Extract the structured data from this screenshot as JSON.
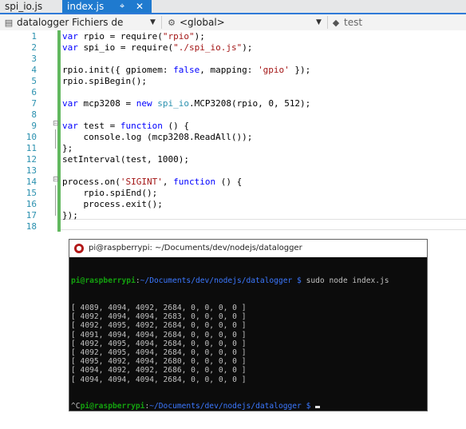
{
  "tabs": [
    {
      "label": "spi_io.js",
      "active": false
    },
    {
      "label": "index.js",
      "active": true,
      "pin": "⌖",
      "close": "✕"
    }
  ],
  "navbar": {
    "project": "datalogger Fichiers de contenu",
    "scope": "<global>",
    "member": "test"
  },
  "editor": {
    "line_numbers": [
      "1",
      "2",
      "3",
      "4",
      "5",
      "6",
      "7",
      "8",
      "9",
      "10",
      "11",
      "12",
      "13",
      "14",
      "15",
      "16",
      "17",
      "18"
    ],
    "lines": [
      {
        "parts": [
          {
            "t": "kw",
            "v": "var"
          },
          {
            "t": "n",
            "v": " rpio = require("
          },
          {
            "t": "str",
            "v": "\"rpio\""
          },
          {
            "t": "n",
            "v": ");"
          }
        ]
      },
      {
        "parts": [
          {
            "t": "kw",
            "v": "var"
          },
          {
            "t": "n",
            "v": " spi_io = require("
          },
          {
            "t": "str",
            "v": "\"./spi_io.js\""
          },
          {
            "t": "n",
            "v": ");"
          }
        ]
      },
      {
        "parts": []
      },
      {
        "parts": [
          {
            "t": "n",
            "v": "rpio.init({ gpiomem: "
          },
          {
            "t": "kw",
            "v": "false"
          },
          {
            "t": "n",
            "v": ", mapping: "
          },
          {
            "t": "str",
            "v": "'gpio'"
          },
          {
            "t": "n",
            "v": " });"
          }
        ]
      },
      {
        "parts": [
          {
            "t": "n",
            "v": "rpio.spiBegin();"
          }
        ]
      },
      {
        "parts": []
      },
      {
        "parts": [
          {
            "t": "kw",
            "v": "var"
          },
          {
            "t": "n",
            "v": " mcp3208 = "
          },
          {
            "t": "kw",
            "v": "new"
          },
          {
            "t": "n",
            "v": " "
          },
          {
            "t": "typ",
            "v": "spi_io"
          },
          {
            "t": "n",
            "v": ".MCP3208(rpio, 0, 512);"
          }
        ]
      },
      {
        "parts": []
      },
      {
        "parts": [
          {
            "t": "kw",
            "v": "var"
          },
          {
            "t": "n",
            "v": " test = "
          },
          {
            "t": "kw",
            "v": "function"
          },
          {
            "t": "n",
            "v": " () {"
          }
        ]
      },
      {
        "parts": [
          {
            "t": "n",
            "v": "    console.log (mcp3208.ReadAll());"
          }
        ]
      },
      {
        "parts": [
          {
            "t": "n",
            "v": "};"
          }
        ]
      },
      {
        "parts": [
          {
            "t": "n",
            "v": "setInterval(test, 1000);"
          }
        ]
      },
      {
        "parts": []
      },
      {
        "parts": [
          {
            "t": "n",
            "v": "process.on("
          },
          {
            "t": "str",
            "v": "'SIGINT'"
          },
          {
            "t": "n",
            "v": ", "
          },
          {
            "t": "kw",
            "v": "function"
          },
          {
            "t": "n",
            "v": " () {"
          }
        ]
      },
      {
        "parts": [
          {
            "t": "n",
            "v": "    rpio.spiEnd();"
          }
        ]
      },
      {
        "parts": [
          {
            "t": "n",
            "v": "    process.exit();"
          }
        ]
      },
      {
        "parts": [
          {
            "t": "n",
            "v": "});"
          }
        ]
      },
      {
        "parts": []
      }
    ]
  },
  "terminal": {
    "title": "pi@raspberrypi: ~/Documents/dev/nodejs/datalogger",
    "prompt_user": "pi@raspberrypi",
    "prompt_path": "~/Documents/dev/nodejs/datalogger $",
    "command": "sudo node index.js",
    "output": [
      "[ 4089, 4094, 4092, 2684, 0, 0, 0, 0 ]",
      "[ 4092, 4094, 4094, 2683, 0, 0, 0, 0 ]",
      "[ 4092, 4095, 4092, 2684, 0, 0, 0, 0 ]",
      "[ 4091, 4094, 4094, 2684, 0, 0, 0, 0 ]",
      "[ 4092, 4095, 4094, 2684, 0, 0, 0, 0 ]",
      "[ 4092, 4095, 4094, 2684, 0, 0, 0, 0 ]",
      "[ 4095, 4092, 4094, 2680, 0, 0, 0, 0 ]",
      "[ 4094, 4092, 4092, 2686, 0, 0, 0, 0 ]",
      "[ 4094, 4094, 4094, 2684, 0, 0, 0, 0 ]"
    ],
    "ctrl_c": "^C",
    "final_prompt_user": "pi@raspberrypi",
    "final_prompt_path": "~/Documents/dev/nodejs/datalogger $"
  }
}
